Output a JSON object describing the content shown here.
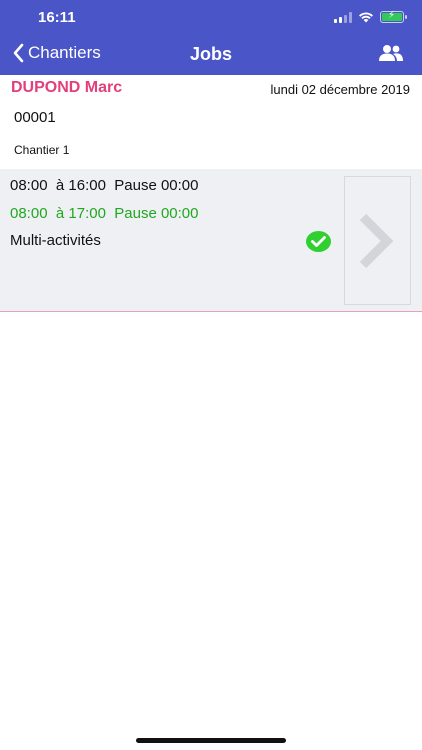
{
  "status_bar": {
    "time": "16:11"
  },
  "nav": {
    "back_label": "Chantiers",
    "title": "Jobs"
  },
  "job": {
    "worker_name": "DUPOND Marc",
    "date": "lundi 02 décembre 2019",
    "number": "00001",
    "site": "Chantier 1",
    "planned": "08:00  à 16:00  Pause 00:00",
    "actual": "08:00  à 17:00  Pause 00:00",
    "activity": "Multi-activités"
  },
  "colors": {
    "header": "#4a55c8",
    "worker_name": "#e23f7c",
    "actual_time": "#1fa81f",
    "check": "#2fd02f",
    "card_background": "#eff0f4"
  }
}
